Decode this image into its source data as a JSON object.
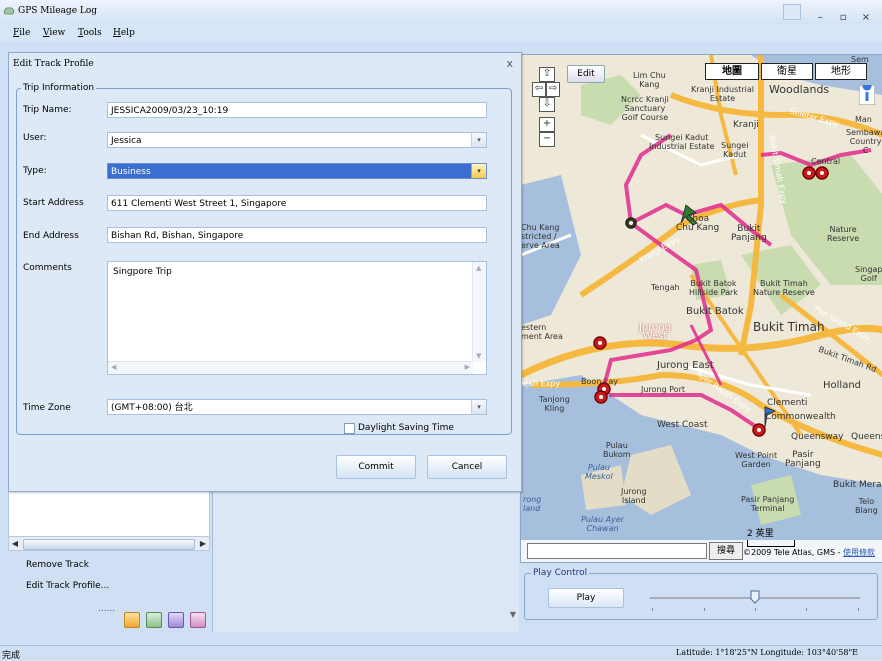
{
  "app": {
    "title": "GPS Mileage Log",
    "window_controls": [
      "–",
      "▫",
      "×"
    ]
  },
  "menu": [
    {
      "label": "File",
      "accel": "F",
      "rest": "ile"
    },
    {
      "label": "View",
      "accel": "V",
      "rest": "iew"
    },
    {
      "label": "Tools",
      "accel": "T",
      "rest": "ools"
    },
    {
      "label": "Help",
      "accel": "H",
      "rest": "elp"
    }
  ],
  "dialog": {
    "title": "Edit Track Profile",
    "close": "x",
    "group_label": "Trip Information",
    "fields": {
      "trip_name": {
        "label": "Trip Name:",
        "value": "JESSICA2009/03/23_10:19"
      },
      "user": {
        "label": "User:",
        "value": "Jessica"
      },
      "type": {
        "label": "Type:",
        "value": "Business"
      },
      "start_address": {
        "label": "Start Address",
        "value": "611 Clementi West Street 1, Singapore"
      },
      "end_address": {
        "label": "End Address",
        "value": "Bishan Rd, Bishan, Singapore"
      },
      "comments": {
        "label": "Comments",
        "value": "Singpore Trip"
      },
      "time_zone": {
        "label": "Time Zone",
        "value": "(GMT+08:00) 台北"
      }
    },
    "daylight_saving": {
      "label": "Daylight Saving Time",
      "checked": false
    },
    "commit_label": "Commit",
    "cancel_label": "Cancel"
  },
  "left_panel": {
    "context_items": [
      "Remove Track",
      "Edit Track Profile..."
    ],
    "dots": "......"
  },
  "map": {
    "edit_label": "Edit",
    "type_buttons": [
      "地圖",
      "衛星",
      "地形"
    ],
    "selected_type": "地圖",
    "search_button": "搜尋",
    "scale_label": "2 英里",
    "copyright": "©2009 Tele Atlas, GMS - ",
    "terms_link": "使用條款",
    "places": {
      "lim_chu_kang": "Lim Chu\nKang",
      "kranji_industrial": "Kranji Industrial\nEstate",
      "woodlands": "Woodlands",
      "ncrcc": "Ncrcc Kranji\nSanctuary\nGolf Course",
      "kranji": "Kranji",
      "seletar_expy": "Seletar Expy",
      "sungei_kadut_ind": "Sungei Kadut\nIndustrial Estate",
      "sungei_kadut": "Sungei\nKadut",
      "sembawang": "Sembawa\nCountry C",
      "central": "Central",
      "bukit_timah_expy": "Bukit Timah Expy",
      "lim_chu_kang_road": "Chu Kang\nstricted /\nerve Area",
      "choa_chu_kang": "Choa\nChu Kang",
      "bukit_panjang": "Bukit\nPanjang",
      "nature_reserve": "Nature\nReserve",
      "kranji_expy": "Kranji Expy",
      "tengah": "Tengah",
      "bukit_batok_park": "Bukit Batok\nHillside Park",
      "bukit_timah_nr": "Bukit Timah\nNature Reserve",
      "singapore_golf": "Singap\nGolf",
      "bukit_batok": "Bukit Batok",
      "pie": "Pan Island Expy",
      "western": "estern\nment Area",
      "jurong_west": "Jurong\nWest",
      "bukit_timah": "Bukit Timah",
      "bukit_timah_rd": "Bukit Timah Rd",
      "jurong_east": "Jurong East",
      "jalan_expy": "ajah Expy",
      "boon_lay": "Boon Lay",
      "jurong_port": "Jurong Port",
      "ayer_rajah": "Ayer Rajah Expy",
      "holland": "Holland",
      "tanjong_kling": "Tanjong\nKling",
      "clementi": "Clementi",
      "commonwealth": "Commonwealth",
      "west_coast": "West Coast",
      "queensway": "Queensway",
      "queens": "Queens",
      "pulau_bukom": "Pulau\nBukom",
      "west_point": "West Point\nGarden",
      "pasir_panjang": "Pasir\nPanjang",
      "pulau_meskol": "Pulau\nMeskol",
      "jurong_island": "Jurong\nIsland",
      "pasir_panjang_terminal": "Pasir Panjang\nTerminal",
      "bukit_merah": "Bukit Mera",
      "telok_blangah": "Telo\nBlang",
      "pulau_ayer_chawan": "Pulau Ayer\nChawan",
      "rong_island": "rong\nland",
      "man": "Man",
      "sem_top": "Sem"
    }
  },
  "play_control": {
    "label": "Play Control",
    "play_button": "Play",
    "slider_fraction": 0.5
  },
  "status": {
    "left": "完成",
    "right": "Latitude: 1°18'25\"N  Longitude: 103°40'58\"E"
  }
}
